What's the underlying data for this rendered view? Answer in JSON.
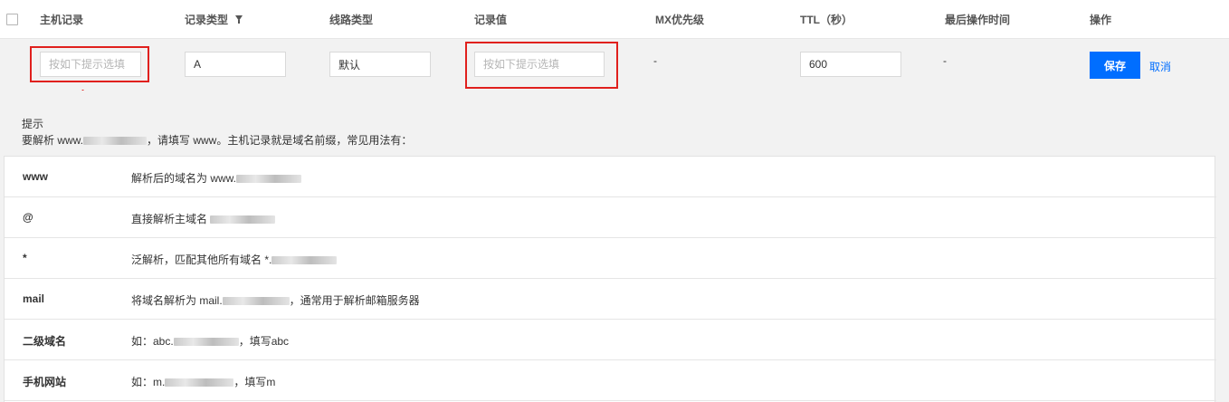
{
  "header": {
    "columns": [
      "主机记录",
      "记录类型",
      "线路类型",
      "记录值",
      "MX优先级",
      "TTL（秒）",
      "最后操作时间",
      "操作"
    ]
  },
  "edit_row": {
    "host_placeholder": "按如下提示选填",
    "type_value": "A",
    "line_value": "默认",
    "value_placeholder": "按如下提示选填",
    "mx_value": "-",
    "ttl_value": "600",
    "last_op_value": "-",
    "save_label": "保存",
    "cancel_label": "取消"
  },
  "annotations": [
    "1",
    "2"
  ],
  "hint": {
    "title": "提示",
    "desc_prefix": "要解析 www.",
    "desc_suffix": "，请填写 www。主机记录就是域名前缀，常见用法有："
  },
  "examples": [
    {
      "key": "www",
      "prefix": "解析后的域名为 www.",
      "suffix": ""
    },
    {
      "key": "@",
      "prefix": "直接解析主域名 ",
      "suffix": ""
    },
    {
      "key": "*",
      "prefix": "泛解析，匹配其他所有域名 *.",
      "suffix": ""
    },
    {
      "key": "mail",
      "prefix": "将域名解析为 mail.",
      "suffix": "，通常用于解析邮箱服务器"
    },
    {
      "key": "二级域名",
      "prefix": "如：abc.",
      "suffix": "，填写abc"
    },
    {
      "key": "手机网站",
      "prefix": "如：m.",
      "suffix": "，填写m"
    }
  ],
  "colors": {
    "accent": "#006eff",
    "annotation": "#e0201d",
    "panel": "#f2f2f2"
  }
}
